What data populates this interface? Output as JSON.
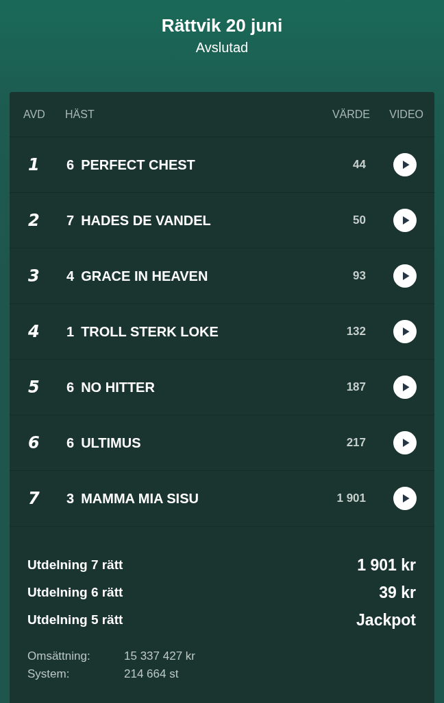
{
  "header": {
    "title": "Rättvik 20 juni",
    "status": "Avslutad"
  },
  "table": {
    "columns": [
      "AVD",
      "HÄST",
      "VÄRDE",
      "VIDEO"
    ],
    "rows": [
      {
        "avd": "1",
        "number": "6",
        "horse": "PERFECT CHEST",
        "value": "44"
      },
      {
        "avd": "2",
        "number": "7",
        "horse": "HADES DE VANDEL",
        "value": "50"
      },
      {
        "avd": "3",
        "number": "4",
        "horse": "GRACE IN HEAVEN",
        "value": "93"
      },
      {
        "avd": "4",
        "number": "1",
        "horse": "TROLL STERK LOKE",
        "value": "132"
      },
      {
        "avd": "5",
        "number": "6",
        "horse": "NO HITTER",
        "value": "187"
      },
      {
        "avd": "6",
        "number": "6",
        "horse": "ULTIMUS",
        "value": "217"
      },
      {
        "avd": "7",
        "number": "3",
        "horse": "MAMMA MIA SISU",
        "value": "1 901"
      }
    ]
  },
  "payouts": [
    {
      "label": "Utdelning 7 rätt",
      "amount": "1 901 kr"
    },
    {
      "label": "Utdelning 6 rätt",
      "amount": "39 kr"
    },
    {
      "label": "Utdelning 5 rätt",
      "amount": "Jackpot"
    }
  ],
  "stats": [
    {
      "label": "Omsättning:",
      "value": "15 337 427 kr"
    },
    {
      "label": "System:",
      "value": "214 664 st"
    }
  ]
}
